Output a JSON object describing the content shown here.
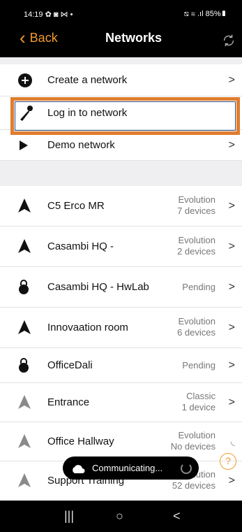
{
  "status_bar": {
    "left": "14:19 ✿ ◙ ⋈ •",
    "right": "⧅ ≋ .ıl 85%▮"
  },
  "header": {
    "back_label": "Back",
    "title": "Networks"
  },
  "actions": [
    {
      "label": "Create a network",
      "arrow": ">"
    },
    {
      "label": "Log in to network",
      "arrow": ""
    },
    {
      "label": "Demo network",
      "arrow": ">"
    }
  ],
  "networks": [
    {
      "name": "C5 Erco MR",
      "type": "Evolution",
      "status": "7 devices",
      "icon": "triangle-icon",
      "arrow": ">"
    },
    {
      "name": "Casambi HQ -",
      "type": "Evolution",
      "status": "2 devices",
      "icon": "triangle-icon",
      "arrow": ">"
    },
    {
      "name": "Casambi HQ - HwLab",
      "type": "",
      "status": "Pending",
      "icon": "lock-icon",
      "arrow": ">"
    },
    {
      "name": "Innovaation room",
      "type": "Evolution",
      "status": "6 devices",
      "icon": "triangle-icon",
      "arrow": ">"
    },
    {
      "name": "OfficeDali",
      "type": "",
      "status": "Pending",
      "icon": "lock-icon",
      "arrow": ">"
    },
    {
      "name": "Entrance",
      "type": "Classic",
      "status": "1 device",
      "icon": "triangle-gray-icon",
      "arrow": ">"
    },
    {
      "name": "Office Hallway",
      "type": "Evolution",
      "status": "No devices",
      "icon": "triangle-gray-icon",
      "arrow": ""
    },
    {
      "name": "Support Training",
      "type": "Evolution",
      "status": "52 devices",
      "icon": "triangle-gray-icon",
      "arrow": ">"
    }
  ],
  "toast": {
    "text": "Communicating..."
  },
  "help": {
    "symbol": "?"
  },
  "nav": {
    "recents": "|||",
    "home": "○",
    "back": "<"
  },
  "colors": {
    "accent": "#f29a2e",
    "highlight": "#e07d2e"
  }
}
